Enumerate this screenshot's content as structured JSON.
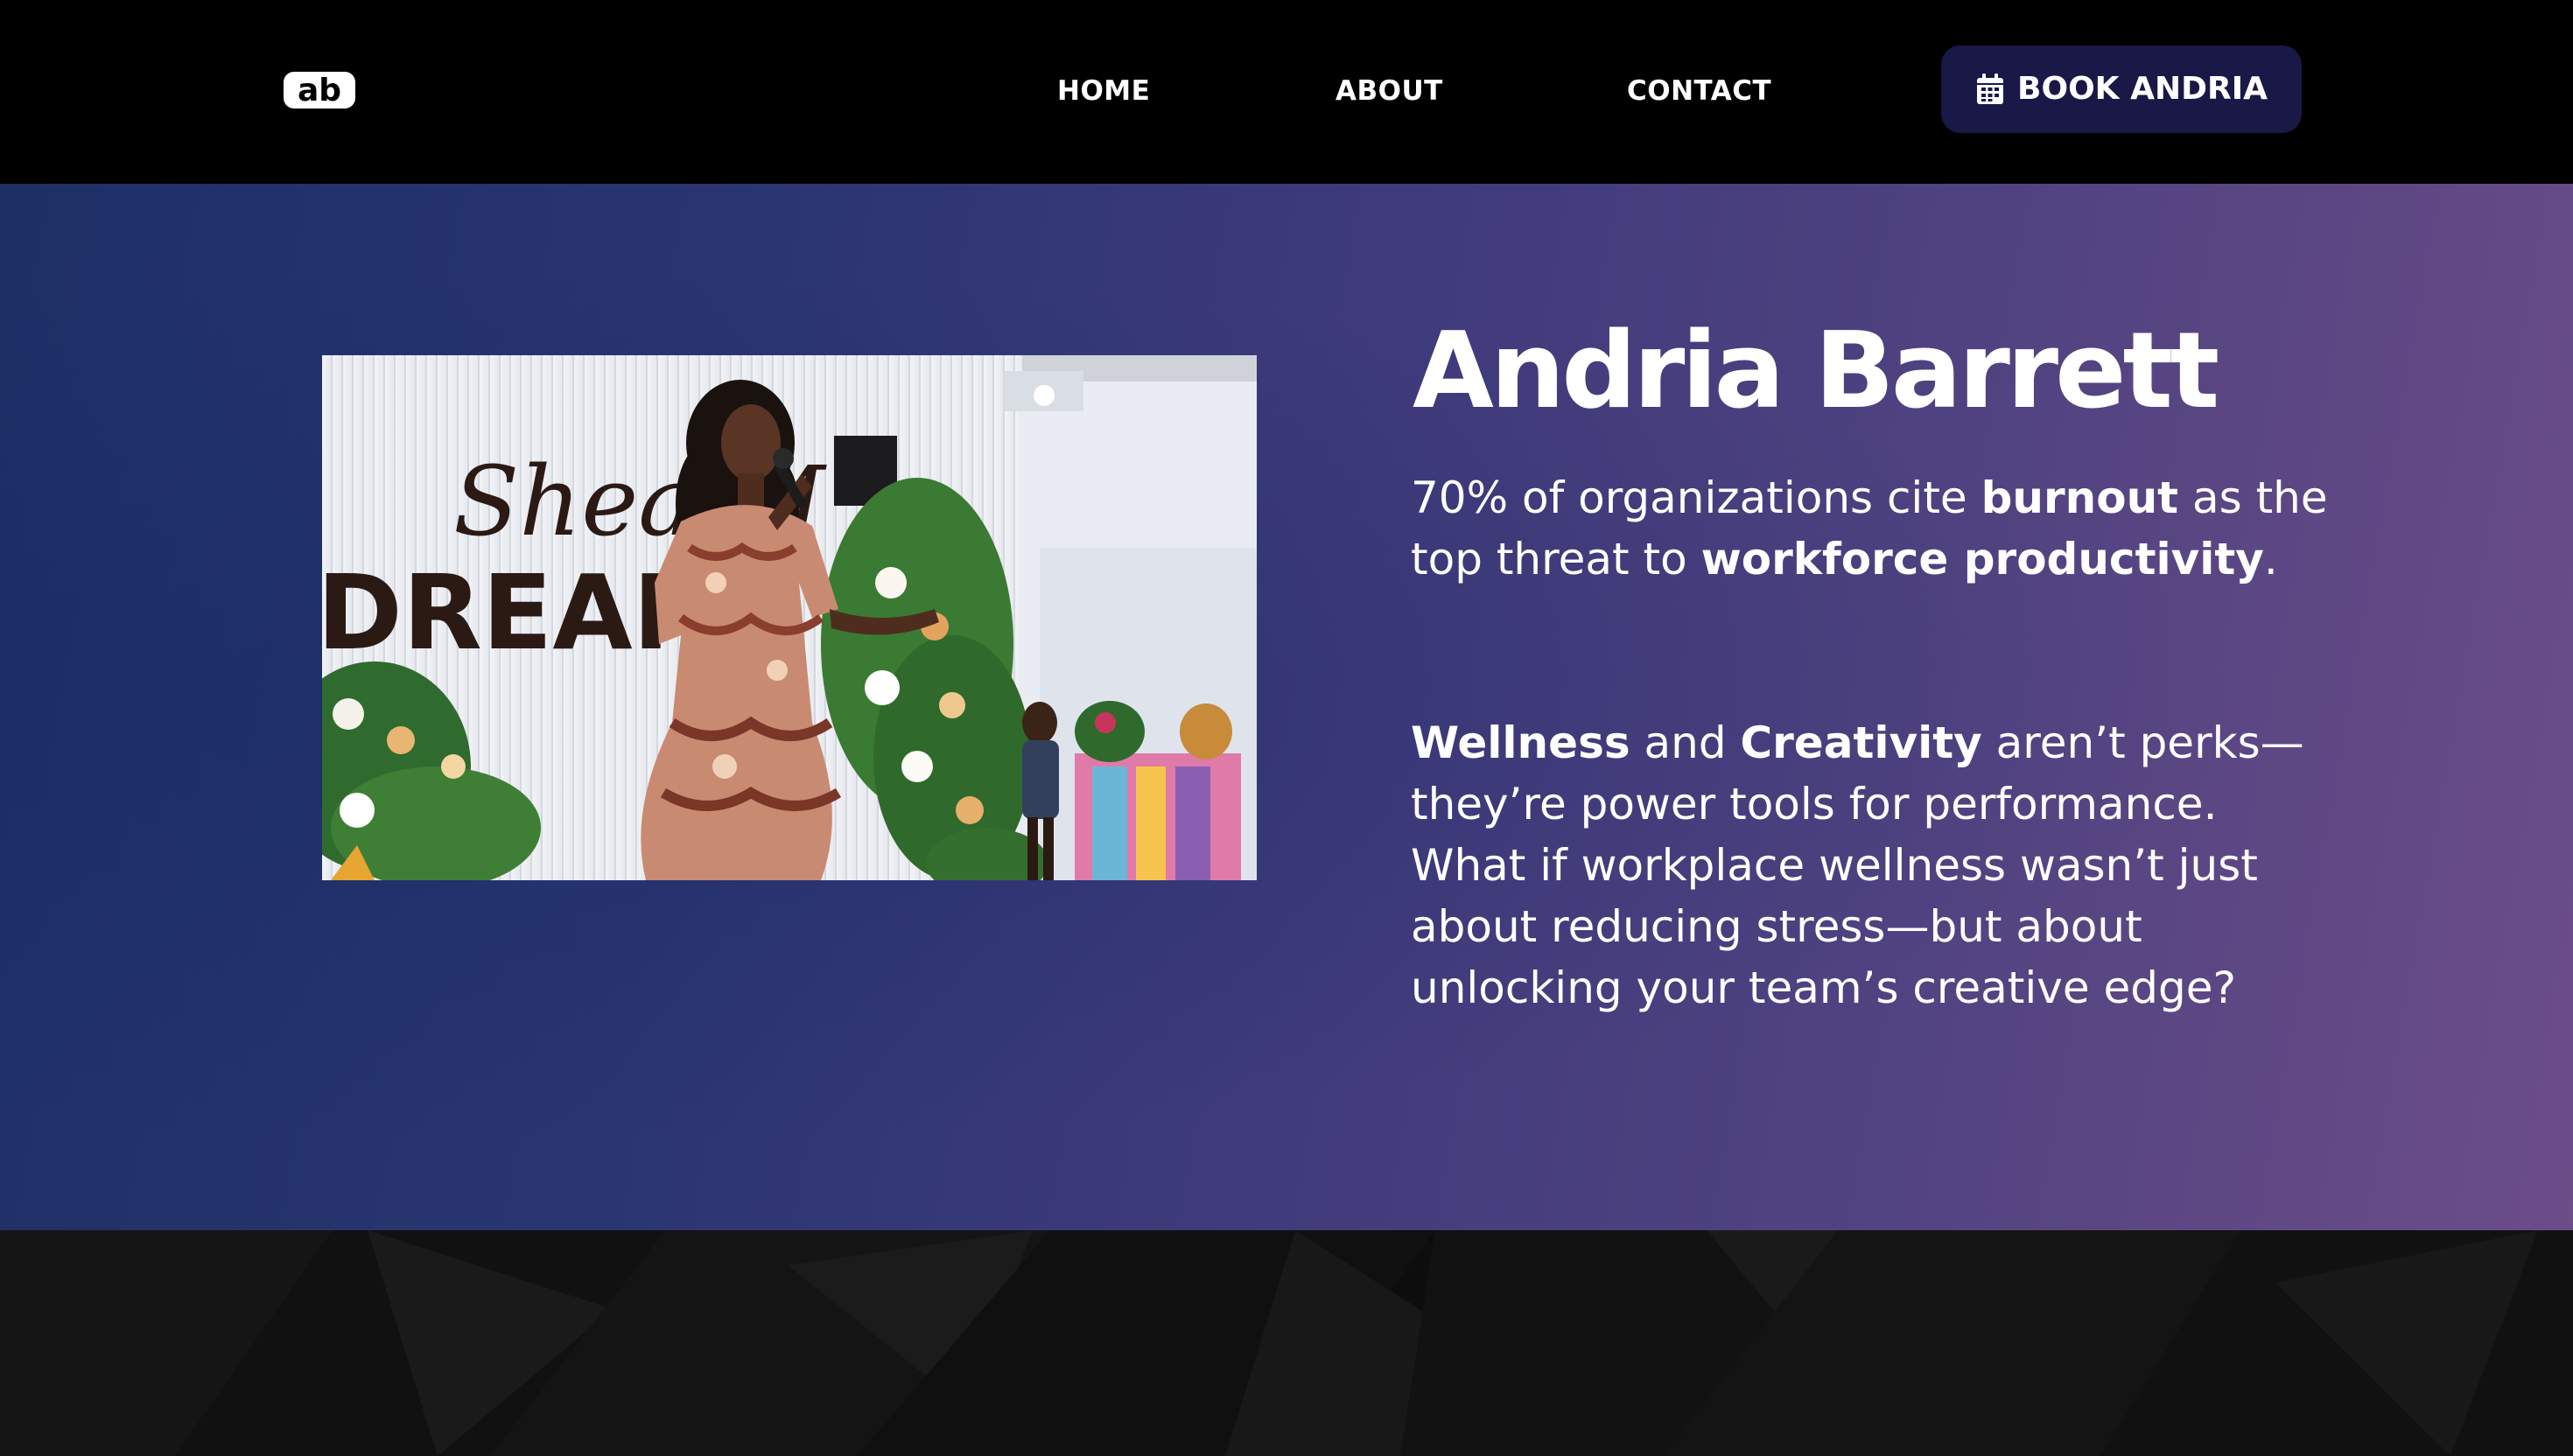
{
  "header": {
    "logo_alt": "ab",
    "nav": [
      {
        "label": "HOME"
      },
      {
        "label": "ABOUT"
      },
      {
        "label": "CONTACT"
      }
    ],
    "cta_label": "BOOK ANDRIA",
    "cta_icon": "calendar-icon"
  },
  "hero": {
    "title": "Andria Barrett",
    "p1": {
      "t1": "70% of organizations cite ",
      "b1": "burnout",
      "t2": " as the top threat to ",
      "b2": "workforce productivity",
      "t3": "."
    },
    "p2": {
      "b1": "Wellness",
      "t1": " and ",
      "b2": "Creativity",
      "t2": " aren’t perks—they’re power tools for performance.",
      "t3": "What if workplace wellness wasn’t just about reducing stress—but about unlocking your team’s creative edge?"
    },
    "photo": {
      "backdrop_script": "Shea M",
      "backdrop_text": "DREAM"
    }
  },
  "colors": {
    "header_bg": "#000000",
    "cta_bg": "#1a1847",
    "hero_gradient_start": "#1e2f66",
    "hero_gradient_end": "#6b4d88",
    "text": "#ffffff"
  }
}
